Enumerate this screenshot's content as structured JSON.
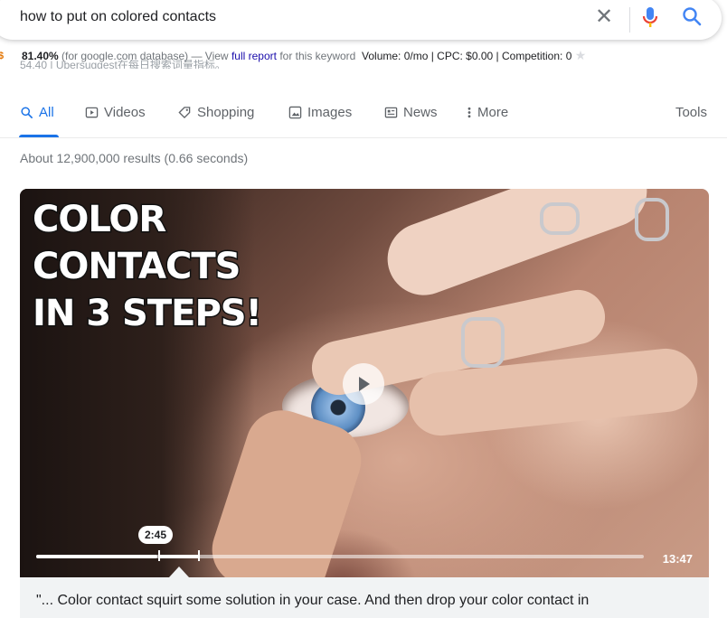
{
  "search": {
    "query": "how to put on colored contacts",
    "clear_icon": "close-icon",
    "voice_icon": "mic-icon",
    "lens_icon": "search-icon"
  },
  "keyword_bar": {
    "score": "81.40%",
    "source": "(for google.com database) — View",
    "report_link": "full report",
    "report_suffix": "for this keyword",
    "metrics": "Volume: 0/mo | CPC: $0.00 | Competition: 0",
    "star": "★"
  },
  "ghost_text": "54.40 | Ubersuggest在每日搜索词量指标。",
  "tabs": [
    {
      "label": "All",
      "icon": "search-icon",
      "active": true
    },
    {
      "label": "Videos",
      "icon": "video-icon"
    },
    {
      "label": "Shopping",
      "icon": "tag-icon"
    },
    {
      "label": "Images",
      "icon": "image-icon"
    },
    {
      "label": "News",
      "icon": "newspaper-icon"
    },
    {
      "label": "More",
      "icon": "more-vert-icon"
    }
  ],
  "tools_label": "Tools",
  "stats": "About 12,900,000 results (0.66 seconds)",
  "video": {
    "title_lines": [
      "COLOR",
      "CONTACTS",
      "IN 3 STEPS!"
    ],
    "timestamp": "2:45",
    "duration": "13:47",
    "progress_fraction": 0.2
  },
  "transcript": "\"... Color contact squirt some solution in your case. And then drop your color contact in",
  "colors": {
    "accent": "#1a73e8",
    "link": "#1a0dab",
    "mic_red": "#ea4335"
  }
}
